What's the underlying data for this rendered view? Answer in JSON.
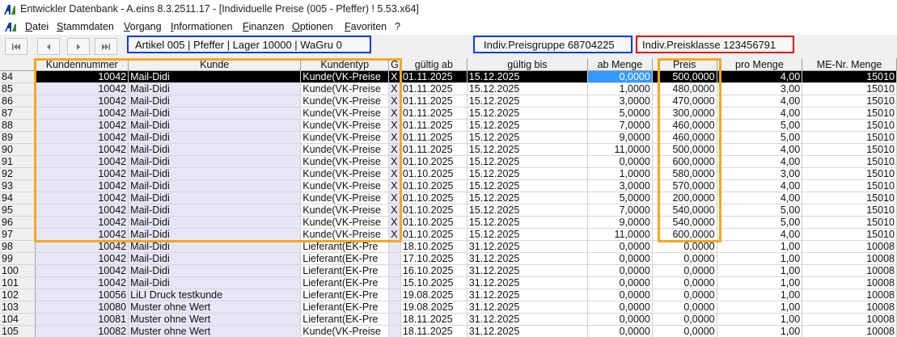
{
  "window": {
    "title": "Entwickler Datenbank - A.eins 8.3.2511.17 - [Individuelle Preise (005 - Pfeffer) ! 5.53.x64]"
  },
  "menu": [
    "Datei",
    "Stammdaten",
    "Vorgang",
    "Informationen",
    "Finanzen",
    "Optionen",
    "Favoriten",
    "?"
  ],
  "info": {
    "artikel": "Artikel 005 | Pfeffer | Lager 10000 | WaGru 0",
    "preisgruppe": "Indiv.Preisgruppe 68704225",
    "preisklasse": "Indiv.Preisklasse 123456791"
  },
  "colors": {
    "blue_frame": "#0a3ce6",
    "red_frame": "#e01010",
    "orange_frame": "#f5a623",
    "selection": "#000000",
    "cell_highlight": "#3399ff",
    "left_column_bg": "#e6e6f7"
  },
  "grid": {
    "columns": [
      "",
      "Kundennummer",
      "Kunde",
      "Kundentyp",
      "G",
      "gültig ab",
      "gültig bis",
      "ab Menge",
      "Preis",
      "pro Menge",
      "ME-Nr. Menge"
    ],
    "selected_row": 84,
    "rows": [
      [
        "84",
        "10042",
        "Mail-Didi",
        "Kunde(VK-Preise",
        "X",
        "01.11.2025",
        "15.12.2025",
        "0,0000",
        "500,0000",
        "4,00",
        "15010"
      ],
      [
        "85",
        "10042",
        "Mail-Didi",
        "Kunde(VK-Preise",
        "X",
        "01.11.2025",
        "15.12.2025",
        "1,0000",
        "480,0000",
        "3,00",
        "15010"
      ],
      [
        "86",
        "10042",
        "Mail-Didi",
        "Kunde(VK-Preise",
        "X",
        "01.11.2025",
        "15.12.2025",
        "3,0000",
        "470,0000",
        "4,00",
        "15010"
      ],
      [
        "87",
        "10042",
        "Mail-Didi",
        "Kunde(VK-Preise",
        "X",
        "01.11.2025",
        "15.12.2025",
        "5,0000",
        "300,0000",
        "4,00",
        "15010"
      ],
      [
        "88",
        "10042",
        "Mail-Didi",
        "Kunde(VK-Preise",
        "X",
        "01.11.2025",
        "15.12.2025",
        "7,0000",
        "460,0000",
        "5,00",
        "15010"
      ],
      [
        "89",
        "10042",
        "Mail-Didi",
        "Kunde(VK-Preise",
        "X",
        "01.11.2025",
        "15.12.2025",
        "9,0000",
        "460,0000",
        "5,00",
        "15010"
      ],
      [
        "90",
        "10042",
        "Mail-Didi",
        "Kunde(VK-Preise",
        "X",
        "01.11.2025",
        "15.12.2025",
        "11,0000",
        "500,0000",
        "4,00",
        "15010"
      ],
      [
        "91",
        "10042",
        "Mail-Didi",
        "Kunde(VK-Preise",
        "X",
        "01.10.2025",
        "15.12.2025",
        "0,0000",
        "600,0000",
        "4,00",
        "15010"
      ],
      [
        "92",
        "10042",
        "Mail-Didi",
        "Kunde(VK-Preise",
        "X",
        "01.10.2025",
        "15.12.2025",
        "1,0000",
        "580,0000",
        "3,00",
        "15010"
      ],
      [
        "93",
        "10042",
        "Mail-Didi",
        "Kunde(VK-Preise",
        "X",
        "01.10.2025",
        "15.12.2025",
        "3,0000",
        "570,0000",
        "4,00",
        "15010"
      ],
      [
        "94",
        "10042",
        "Mail-Didi",
        "Kunde(VK-Preise",
        "X",
        "01.10.2025",
        "15.12.2025",
        "5,0000",
        "200,0000",
        "4,00",
        "15010"
      ],
      [
        "95",
        "10042",
        "Mail-Didi",
        "Kunde(VK-Preise",
        "X",
        "01.10.2025",
        "15.12.2025",
        "7,0000",
        "540,0000",
        "5,00",
        "15010"
      ],
      [
        "96",
        "10042",
        "Mail-Didi",
        "Kunde(VK-Preise",
        "X",
        "01.10.2025",
        "15.12.2025",
        "9,0000",
        "540,0000",
        "5,00",
        "15010"
      ],
      [
        "97",
        "10042",
        "Mail-Didi",
        "Kunde(VK-Preise",
        "X",
        "01.10.2025",
        "15.12.2025",
        "11,0000",
        "600,0000",
        "4,00",
        "15010"
      ],
      [
        "98",
        "10042",
        "Mail-Didi",
        "Lieferant(EK-Pre",
        "",
        "18.10.2025",
        "31.12.2025",
        "0,0000",
        "0,0000",
        "1,00",
        "10008"
      ],
      [
        "99",
        "10042",
        "Mail-Didi",
        "Lieferant(EK-Pre",
        "",
        "17.10.2025",
        "31.12.2025",
        "0,0000",
        "0,0000",
        "1,00",
        "10008"
      ],
      [
        "100",
        "10042",
        "Mail-Didi",
        "Lieferant(EK-Pre",
        "",
        "16.10.2025",
        "31.12.2025",
        "0,0000",
        "0,0000",
        "1,00",
        "10008"
      ],
      [
        "101",
        "10042",
        "Mail-Didi",
        "Lieferant(EK-Pre",
        "",
        "15.10.2025",
        "31.12.2025",
        "0,0000",
        "0,0000",
        "1,00",
        "10008"
      ],
      [
        "102",
        "10056",
        "LiLI Druck testkunde",
        "Lieferant(EK-Pre",
        "",
        "19.08.2025",
        "31.12.2025",
        "0,0000",
        "0,0000",
        "1,00",
        "10008"
      ],
      [
        "103",
        "10080",
        "Muster ohne Wert",
        "Lieferant(EK-Pre",
        "",
        "19.08.2025",
        "31.12.2025",
        "0,0000",
        "0,0000",
        "1,00",
        "10008"
      ],
      [
        "104",
        "10081",
        "Muster ohne Wert",
        "Lieferant(EK-Pre",
        "",
        "18.11.2025",
        "31.12.2025",
        "0,0000",
        "0,0000",
        "1,00",
        "10008"
      ],
      [
        "105",
        "10082",
        "Muster ohne Wert",
        "Kunde(VK-Preise",
        "",
        "18.11.2025",
        "31.12.2025",
        "0,0000",
        "0,0000",
        "1,00",
        "10008"
      ]
    ]
  }
}
